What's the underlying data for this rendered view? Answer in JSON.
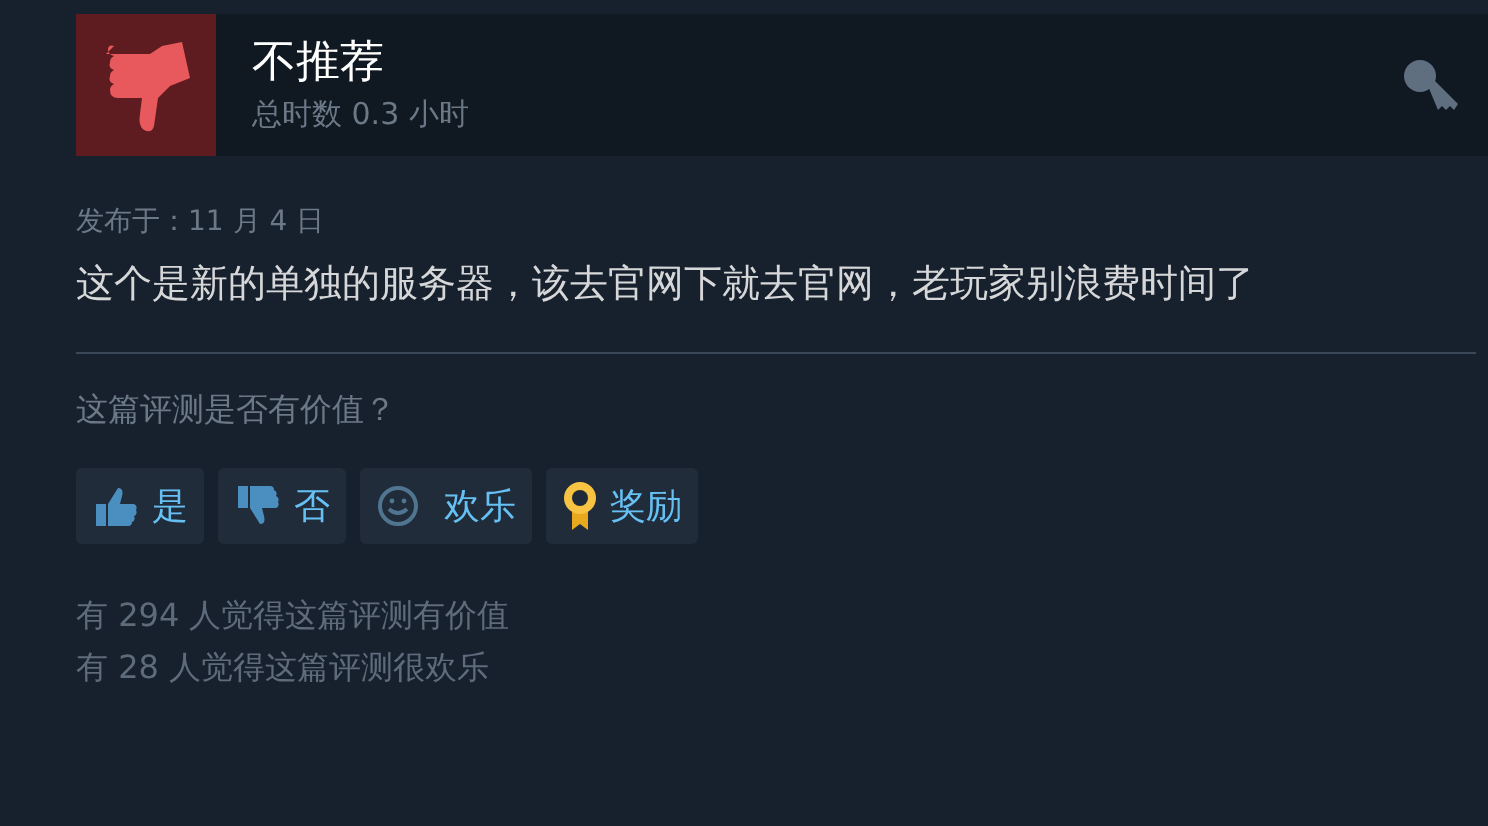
{
  "header": {
    "verdict": "不推荐",
    "recommended": false,
    "playtime": "总时数 0.3 小时"
  },
  "posted": "发布于：11 月 4 日",
  "review_text": "这个是新的单独的服务器，该去官网下就去官网，老玩家别浪费时间了",
  "question": "这篇评测是否有价值？",
  "buttons": [
    {
      "kind": "up",
      "label": "是"
    },
    {
      "kind": "down",
      "label": "否"
    },
    {
      "kind": "funny",
      "label": "欢乐"
    },
    {
      "kind": "award",
      "label": "奖励"
    }
  ],
  "stats": [
    "有 294 人觉得这篇评测有价值",
    "有 28 人觉得这篇评测很欢乐"
  ]
}
